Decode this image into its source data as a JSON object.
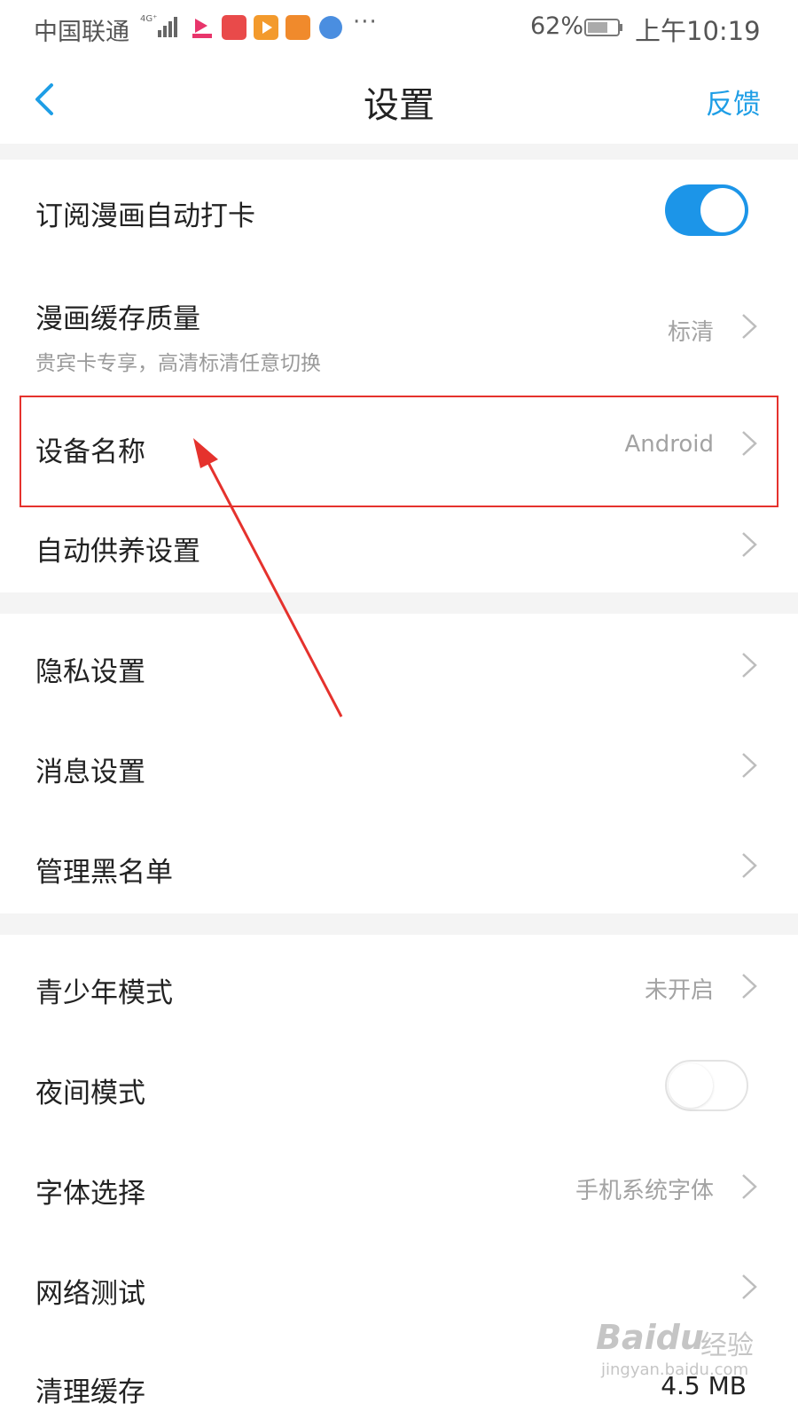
{
  "status_bar": {
    "carrier": "中国联通",
    "battery_percent": "62%",
    "time": "上午10:19",
    "more": "···"
  },
  "nav": {
    "title": "设置",
    "feedback": "反馈"
  },
  "rows": [
    {
      "label": "订阅漫画自动打卡",
      "toggle": true
    },
    {
      "label": "漫画缓存质量",
      "sub": "贵宾卡专享，高清标清任意切换",
      "value": "标清"
    },
    {
      "label": "设备名称",
      "value": "Android"
    },
    {
      "label": "自动供养设置",
      "value": ""
    },
    {
      "label": "隐私设置"
    },
    {
      "label": "消息设置"
    },
    {
      "label": "管理黑名单"
    },
    {
      "label": "青少年模式",
      "value": "未开启"
    },
    {
      "label": "夜间模式",
      "toggle": false
    },
    {
      "label": "字体选择",
      "value": "手机系统字体"
    },
    {
      "label": "网络测试"
    },
    {
      "label": "清理缓存",
      "value": "4.5 MB"
    }
  ],
  "watermark": {
    "logo": "Baidu",
    "cn": "经验",
    "url": "jingyan.baidu.com"
  },
  "colors": {
    "accent": "#1e9ee6",
    "toggle_on": "#1c95e8",
    "annotation_red": "#e5322d"
  }
}
